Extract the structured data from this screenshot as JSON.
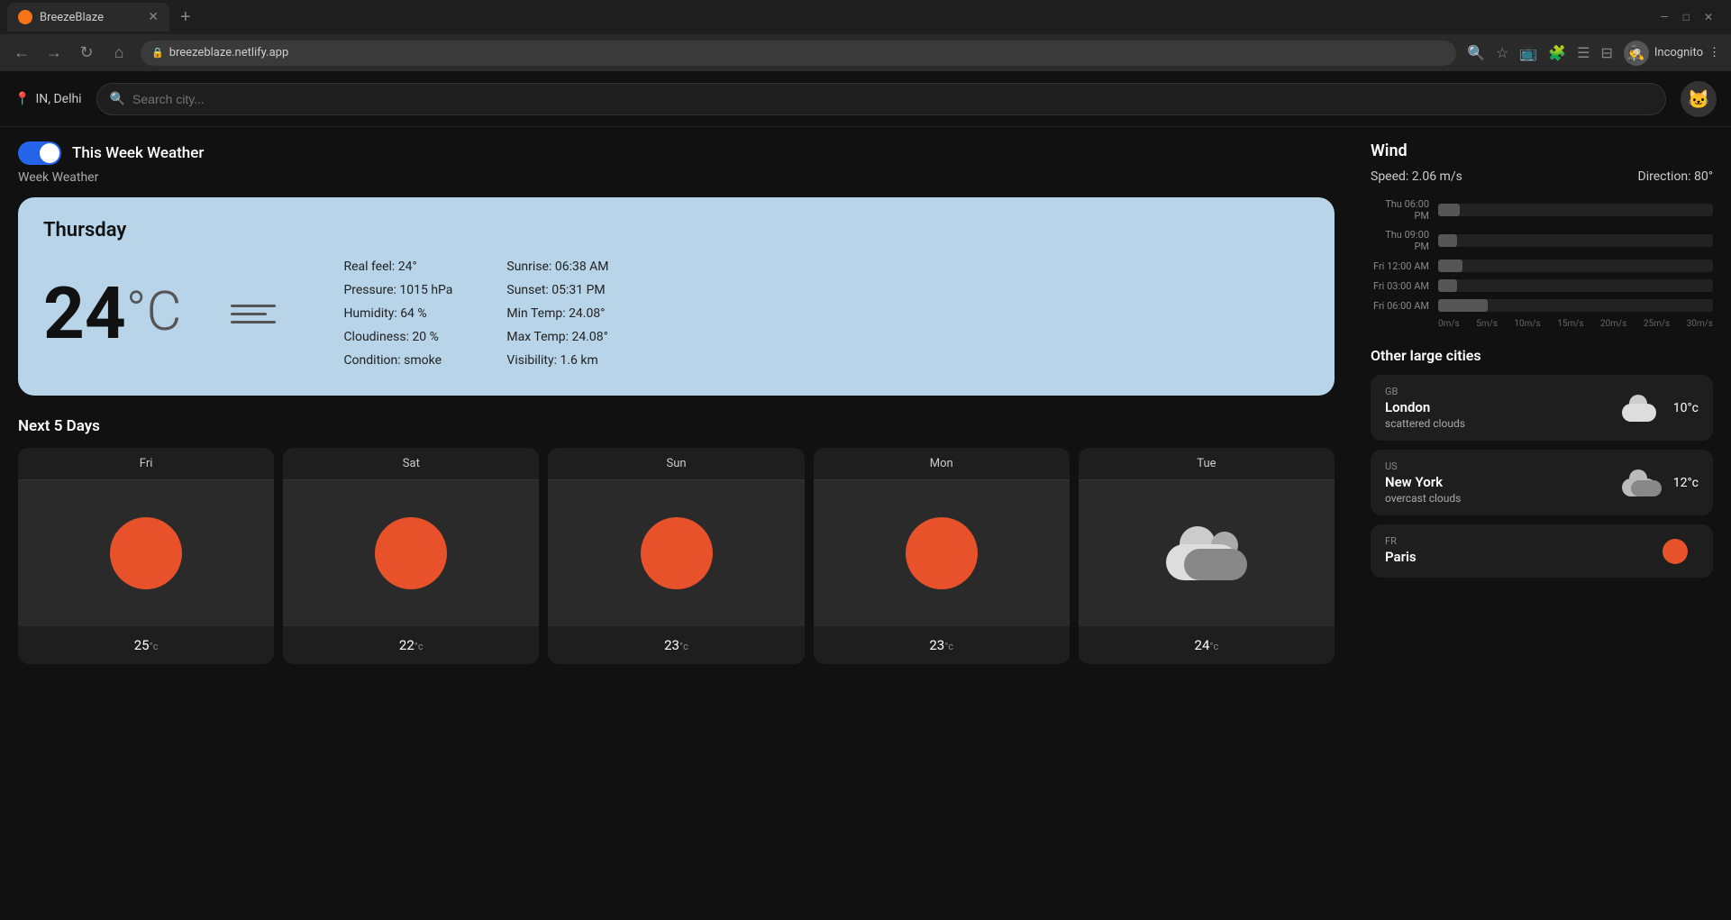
{
  "browser": {
    "tab_title": "BreezeBlaze",
    "tab_favicon": "🟠",
    "url": "breezeblaze.netlify.app",
    "incognito_label": "Incognito"
  },
  "header": {
    "location": "IN, Delhi",
    "search_placeholder": "Search city...",
    "user_icon": "👤"
  },
  "toggle": {
    "label": "This Week Weather"
  },
  "section": {
    "week_weather_label": "Week Weather"
  },
  "today": {
    "day": "Thursday",
    "temperature": "24",
    "unit": "°C",
    "real_feel": "Real feel: 24°",
    "pressure": "Pressure: 1015 hPa",
    "humidity": "Humidity: 64 %",
    "cloudiness": "Cloudiness: 20 %",
    "condition": "Condition: smoke",
    "sunrise": "Sunrise: 06:38 AM",
    "sunset": "Sunset: 05:31 PM",
    "min_temp": "Min Temp: 24.08°",
    "max_temp": "Max Temp: 24.08°",
    "visibility": "Visibility: 1.6 km"
  },
  "next_days": {
    "title": "Next 5 Days",
    "days": [
      {
        "name": "Fri",
        "temp": "25",
        "type": "sun"
      },
      {
        "name": "Sat",
        "temp": "22",
        "type": "sun"
      },
      {
        "name": "Sun",
        "temp": "23",
        "type": "sun"
      },
      {
        "name": "Mon",
        "temp": "23",
        "type": "sun"
      },
      {
        "name": "Tue",
        "temp": "24",
        "type": "cloud"
      }
    ]
  },
  "wind": {
    "title": "Wind",
    "speed": "Speed: 2.06 m/s",
    "direction": "Direction: 80°",
    "bars": [
      {
        "label": "Thu 06:00 PM",
        "width_pct": 8
      },
      {
        "label": "Thu 09:00 PM",
        "width_pct": 7
      },
      {
        "label": "Fri 12:00 AM",
        "width_pct": 9
      },
      {
        "label": "Fri 03:00 AM",
        "width_pct": 7
      },
      {
        "label": "Fri 06:00 AM",
        "width_pct": 18
      }
    ],
    "axis": [
      "0m/s",
      "5m/s",
      "10m/s",
      "15m/s",
      "20m/s",
      "25m/s",
      "30m/s"
    ]
  },
  "cities": {
    "title": "Other large cities",
    "list": [
      {
        "country": "GB",
        "name": "London",
        "condition": "scattered clouds",
        "temp": "10°c",
        "type": "light-cloud"
      },
      {
        "country": "US",
        "name": "New York",
        "condition": "overcast clouds",
        "temp": "12°c",
        "type": "dark-cloud"
      },
      {
        "country": "FR",
        "name": "Paris",
        "condition": "",
        "temp": "",
        "type": "sun"
      }
    ]
  }
}
